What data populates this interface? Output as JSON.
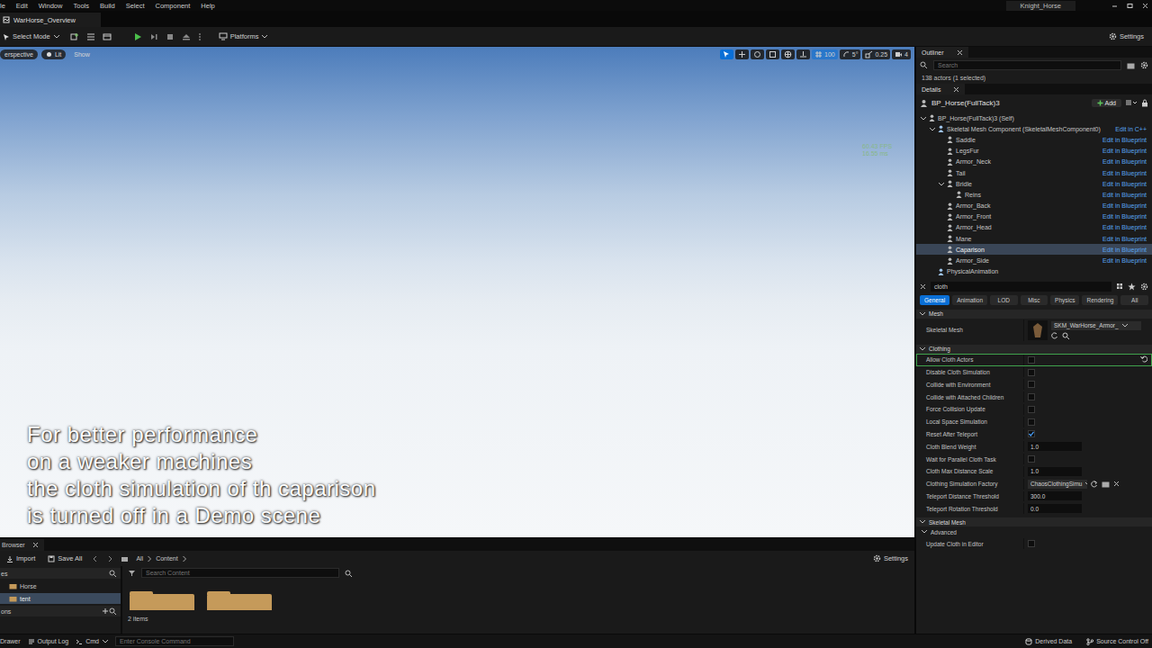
{
  "menu_bar": {
    "items": [
      "le",
      "Edit",
      "Window",
      "Tools",
      "Build",
      "Select",
      "Component",
      "Help"
    ],
    "project": "Knight_Horse"
  },
  "document_tab": {
    "label": "WarHorse_Overview"
  },
  "toolbar": {
    "mode": "Select Mode",
    "platforms": "Platforms",
    "settings": "Settings"
  },
  "viewport": {
    "view_mode": "erspective",
    "lighting": "Lit",
    "show": "Show",
    "snaps": [
      {
        "label": "100",
        "selected": true
      },
      {
        "label": "5°",
        "selected": false
      },
      {
        "label": "0.25",
        "selected": false
      },
      {
        "label": "4",
        "selected": false
      }
    ],
    "fps": "60.43 FPS",
    "frame_time": "16.55 ms",
    "caption": [
      "For better performance",
      "on a weaker machines",
      "the cloth simulation of th caparison",
      "is turned off in a Demo scene"
    ]
  },
  "outliner": {
    "tab": "Outliner",
    "search_placeholder": "Search",
    "count": "138 actors (1 selected)"
  },
  "details": {
    "tab": "Details",
    "actor": "BP_Horse(FullTack)3",
    "add_button": "Add",
    "components": [
      {
        "label": "BP_Horse(FullTack)3 (Self)",
        "action": "",
        "depth": 0,
        "kind": "branch",
        "expanded": true,
        "selected": false
      },
      {
        "label": "Skeletal Mesh Component (SkeletalMeshComponent0)",
        "action": "Edit in C++",
        "depth": 1,
        "kind": "branch",
        "expanded": true,
        "selected": false
      },
      {
        "label": "Saddle",
        "action": "Edit in Blueprint",
        "depth": 2,
        "kind": "leaf",
        "expanded": false,
        "selected": false
      },
      {
        "label": "LegsFur",
        "action": "Edit in Blueprint",
        "depth": 2,
        "kind": "leaf",
        "expanded": false,
        "selected": false
      },
      {
        "label": "Armor_Neck",
        "action": "Edit in Blueprint",
        "depth": 2,
        "kind": "leaf",
        "expanded": false,
        "selected": false
      },
      {
        "label": "Tail",
        "action": "Edit in Blueprint",
        "depth": 2,
        "kind": "leaf",
        "expanded": false,
        "selected": false
      },
      {
        "label": "Bridle",
        "action": "Edit in Blueprint",
        "depth": 2,
        "kind": "branch",
        "expanded": true,
        "selected": false
      },
      {
        "label": "Reins",
        "action": "Edit in Blueprint",
        "depth": 3,
        "kind": "leaf",
        "expanded": false,
        "selected": false
      },
      {
        "label": "Armor_Back",
        "action": "Edit in Blueprint",
        "depth": 2,
        "kind": "leaf",
        "expanded": false,
        "selected": false
      },
      {
        "label": "Armor_Front",
        "action": "Edit in Blueprint",
        "depth": 2,
        "kind": "leaf",
        "expanded": false,
        "selected": false
      },
      {
        "label": "Armor_Head",
        "action": "Edit in Blueprint",
        "depth": 2,
        "kind": "leaf",
        "expanded": false,
        "selected": false
      },
      {
        "label": "Mane",
        "action": "Edit in Blueprint",
        "depth": 2,
        "kind": "leaf",
        "expanded": false,
        "selected": false
      },
      {
        "label": "Caparison",
        "action": "Edit in Blueprint",
        "depth": 2,
        "kind": "leaf",
        "expanded": false,
        "selected": true
      },
      {
        "label": "Armor_Side",
        "action": "Edit in Blueprint",
        "depth": 2,
        "kind": "leaf",
        "expanded": false,
        "selected": false
      },
      {
        "label": "PhysicalAnimation",
        "action": "",
        "depth": 1,
        "kind": "leaf",
        "expanded": false,
        "selected": false
      }
    ],
    "filter": "cloth",
    "categories": [
      {
        "label": "General",
        "selected": true
      },
      {
        "label": "Animation",
        "selected": false
      },
      {
        "label": "LOD",
        "selected": false
      },
      {
        "label": "Misc",
        "selected": false
      },
      {
        "label": "Physics",
        "selected": false
      },
      {
        "label": "Rendering",
        "selected": false
      },
      {
        "label": "All",
        "selected": false
      }
    ],
    "sections": [
      {
        "title": "Mesh",
        "expanded": true,
        "rows": [
          {
            "label": "Skeletal Mesh",
            "kind": "asset",
            "value": "SKM_WarHorse_Armor_",
            "checked": false,
            "highlighted": false,
            "modified": false
          }
        ]
      },
      {
        "title": "Clothing",
        "expanded": true,
        "rows": [
          {
            "label": "Allow Cloth Actors",
            "kind": "checkbox",
            "value": "",
            "checked": false,
            "highlighted": true,
            "modified": true
          },
          {
            "label": "Disable Cloth Simulation",
            "kind": "checkbox",
            "value": "",
            "checked": false,
            "highlighted": false,
            "modified": false
          },
          {
            "label": "Collide with Environment",
            "kind": "checkbox",
            "value": "",
            "checked": false,
            "highlighted": false,
            "modified": false
          },
          {
            "label": "Collide with Attached Children",
            "kind": "checkbox",
            "value": "",
            "checked": false,
            "highlighted": false,
            "modified": false
          },
          {
            "label": "Force Collision Update",
            "kind": "checkbox",
            "value": "",
            "checked": false,
            "highlighted": false,
            "modified": false
          },
          {
            "label": "Local Space Simulation",
            "kind": "checkbox",
            "value": "",
            "checked": false,
            "highlighted": false,
            "modified": false
          },
          {
            "label": "Reset After Teleport",
            "kind": "checkbox",
            "value": "",
            "checked": true,
            "highlighted": false,
            "modified": false
          },
          {
            "label": "Cloth Blend Weight",
            "kind": "number",
            "value": "1.0",
            "checked": false,
            "highlighted": false,
            "modified": false
          },
          {
            "label": "Wait for Parallel Cloth Task",
            "kind": "checkbox",
            "value": "",
            "checked": false,
            "highlighted": false,
            "modified": false
          },
          {
            "label": "Cloth Max Distance Scale",
            "kind": "number",
            "value": "1.0",
            "checked": false,
            "highlighted": false,
            "modified": false
          },
          {
            "label": "Clothing Simulation Factory",
            "kind": "dropdown",
            "value": "ChaosClothingSimu",
            "checked": false,
            "highlighted": false,
            "modified": false
          },
          {
            "label": "Teleport Distance Threshold",
            "kind": "number",
            "value": "300.0",
            "checked": false,
            "highlighted": false,
            "modified": false
          },
          {
            "label": "Teleport Rotation Threshold",
            "kind": "number",
            "value": "0.0",
            "checked": false,
            "highlighted": false,
            "modified": false
          }
        ]
      },
      {
        "title": "Skeletal Mesh",
        "expanded": true,
        "rows": [
          {
            "label": "Advanced",
            "kind": "group",
            "value": "",
            "checked": false,
            "highlighted": false,
            "modified": false
          },
          {
            "label": "Update Cloth in Editor",
            "kind": "checkbox",
            "value": "",
            "checked": false,
            "highlighted": false,
            "modified": false
          }
        ]
      }
    ]
  },
  "content_browser": {
    "tab": "Browser",
    "import": "Import",
    "save_all": "Save All",
    "path": [
      "All",
      "Content"
    ],
    "settings": "Settings",
    "search_placeholder": "Search Content",
    "tree": [
      {
        "label": "es",
        "kind": "header",
        "selected": false
      },
      {
        "label": "Horse",
        "kind": "item",
        "selected": false
      },
      {
        "label": "tent",
        "kind": "item",
        "selected": true
      },
      {
        "label": "ons",
        "kind": "header",
        "selected": false
      }
    ],
    "folders": [
      {
        "selected": false
      },
      {
        "selected": false
      }
    ],
    "count": "2 items"
  },
  "status_bar": {
    "drawer": "Drawer",
    "output_log": "Output Log",
    "cmd": "Cmd",
    "console_placeholder": "Enter Console Command",
    "derived_data": "Derived Data",
    "source_control": "Source Control Off"
  }
}
